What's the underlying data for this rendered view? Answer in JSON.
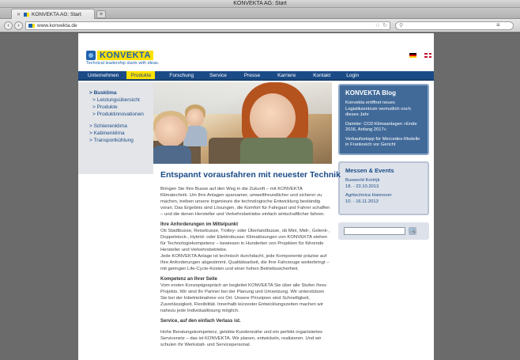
{
  "window": {
    "title": "KONVEKTA AG: Start"
  },
  "tabs": [
    {
      "label": "KONVEKTA AG: Start",
      "close": "✕"
    }
  ],
  "newtab": "+",
  "address": {
    "url": "www.konvekta.de"
  },
  "site": {
    "logo": {
      "name": "KONVEKTA",
      "tagline": "Technical leadership starts with ideas."
    },
    "nav": [
      {
        "label": "Unternehmen",
        "active": false
      },
      {
        "label": "Produkte",
        "active": true
      },
      {
        "label": "Forschung",
        "active": false
      },
      {
        "label": "Service",
        "active": false
      },
      {
        "label": "Presse",
        "active": false
      },
      {
        "label": "Karriere",
        "active": false
      },
      {
        "label": "Kontakt",
        "active": false
      },
      {
        "label": "Login",
        "active": false
      }
    ],
    "subnav": [
      {
        "label": "> Busklima",
        "level": 1
      },
      {
        "label": "> Leistungsübersicht",
        "level": 2
      },
      {
        "label": "> Produkte",
        "level": 2
      },
      {
        "label": "> Produktinnovationen",
        "level": 2
      },
      {
        "label": "> Schienenklima",
        "level": 1
      },
      {
        "label": "> Kabinenklima",
        "level": 1
      },
      {
        "label": "> Transportkühlung",
        "level": 1
      }
    ],
    "content": {
      "heading": "Entspannt vorausfahren mit neuester Technik",
      "intro": "Bringen Sie Ihre Busse auf den Weg in die Zukunft – mit KONVEKTA Klimatechnik. Um Ihre Anlagen sparsamer, umweltfreundlicher und sicherer zu machen, treiben unsere Ingenieure die technologische Entwicklung beständig voran. Das Ergebnis sind Lösungen, die Komfort für Fahrgast und Fahrer schaffen – und die denen Hersteller und Verkehrsbetriebe einfach wirtschaftlicher fahren.",
      "section1_title": "Ihre Anforderungen im Mittelpunkt",
      "section1_text": "Ob Stadtbusse, Reisebusse, Trolley- oder Überlandbusse, ob Mini, Midi-, Gelenk-, Doppelstock-, Hybrid- oder Elektrobusse: Klimalösungen von KONVEKTA stehen für Technologiekompetenz – bewiesen in Hunderten von Projekten für führende Hersteller und Verkehrsbetriebe.",
      "section1_text2": "Jede KONVEKTA Anlage ist technisch durchdacht, jede Komponente präzise auf Ihre Anforderungen abgestimmt. Qualitätsarbeit, die Ihre Fahrzeuge weiterbringt – mit geringen Life-Cycle-Kosten und einer hohen Betriebssicherheit.",
      "section2_title": "Kompetenz an Ihrer Seite",
      "section2_text": "Vom ersten Konzeptgespräch an begleitet KONVEKTA Sie über alle Stufen Ihres Projekts. Wir sind Ihr Partner bei der Planung und Umsetzung. Wir unterstützen Sie bei der Inbetriebnahme vor Ort. Unsere Prinzipien sind Schnelligkeit, Zuverlässigkeit, Flexibilität. Innerhalb kürzester Entwicklungszeiten machen wir nahezu jede Individuallösung möglich.",
      "section3_title": "Service, auf den einfach Verlass ist.",
      "section3_text": "Hohe Beratungskompetenz, gelebte Kundennähe und ein perfekt organisiertes Servicenetz – das ist KONVEKTA. Wir planen, entwickeln, realisieren. Und wir schulen Ihr Werkstatt- und Servicepersonal."
    },
    "blog": {
      "title": "KONVEKTA Blog",
      "items": [
        "Konvekta eröffnet neues Logistikzentrum vermutlich noch dieses Jahr",
        "Daimler: CO2-Klimaanlagen »Ende 2016, Anfang 2017«",
        "Verkaufsstopp für Mercedes-Modelle in Frankreich vor Gericht"
      ]
    },
    "events": {
      "title": "Messen & Events",
      "items": [
        {
          "name": "Busworld Kortrijk",
          "date": "18. - 23.10.2013"
        },
        {
          "name": "Agritechnica Hannover",
          "date": "10. - 16.11.2013"
        }
      ]
    },
    "search": {
      "value": "",
      "button": "🔍"
    }
  },
  "colors": {
    "brand_blue": "#1b4b87",
    "brand_yellow": "#ffe000",
    "blog_bg": "#416a99"
  }
}
